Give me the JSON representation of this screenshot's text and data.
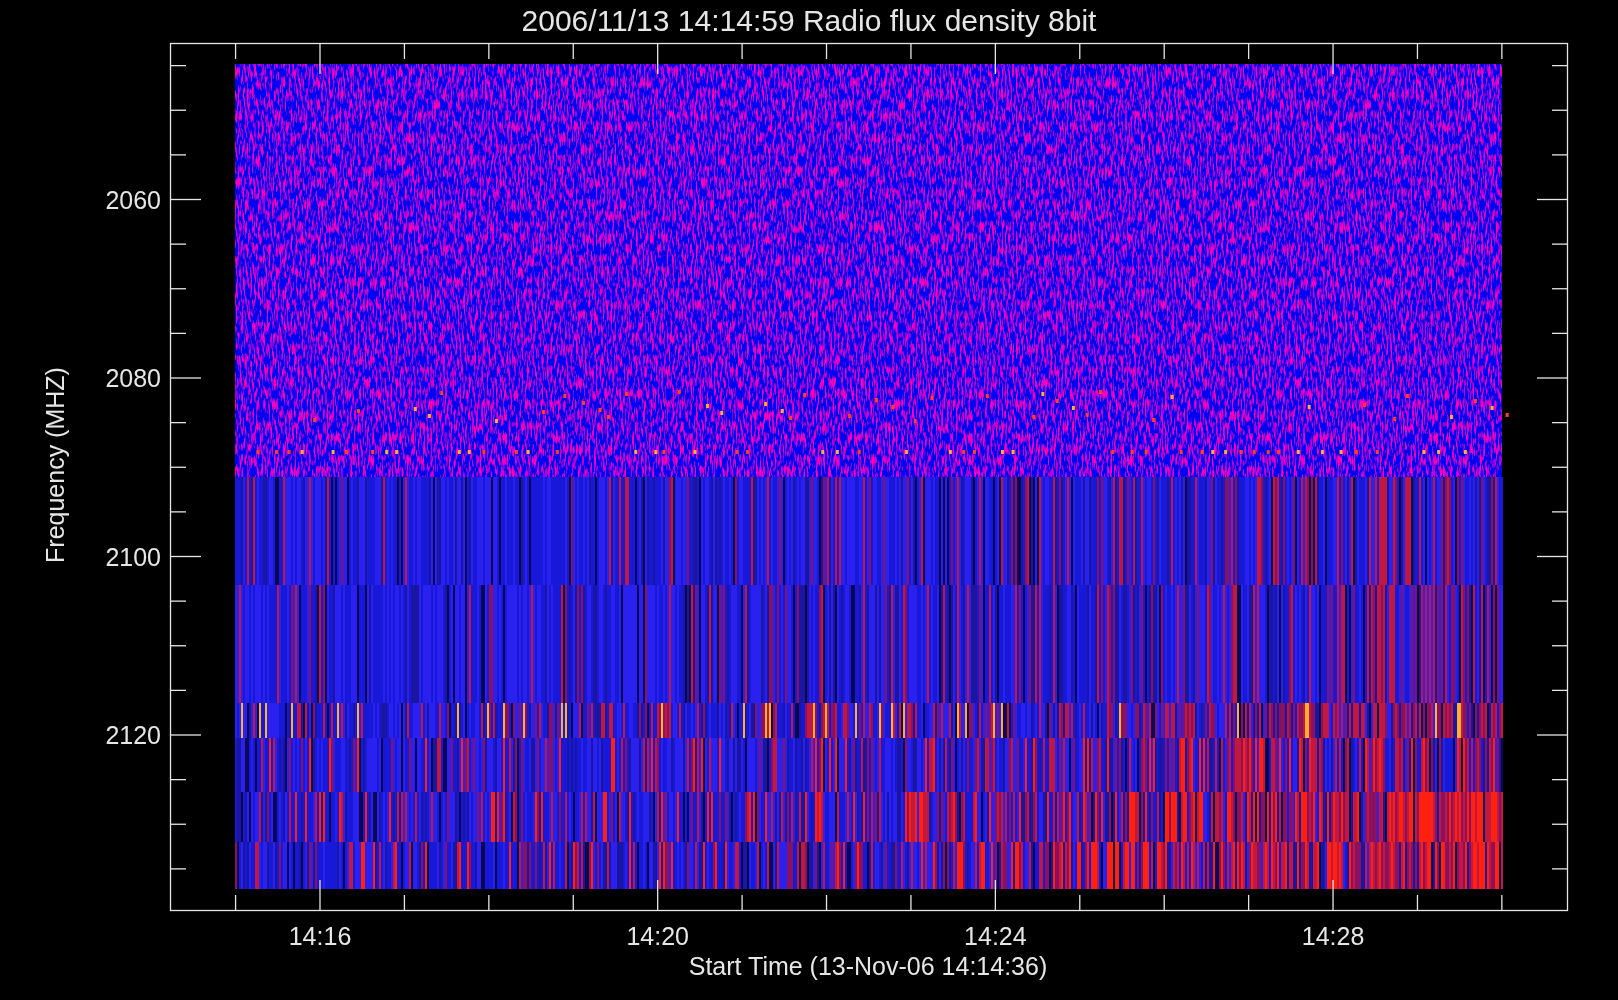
{
  "title": "2006/11/13 14:14:59 Radio flux density 8bit",
  "plot": {
    "xlabel": "Start Time (13-Nov-06 14:14:36)",
    "ylabel": "Frequency (MHZ)",
    "x_tick_labels": [
      "14:16",
      "14:20",
      "14:24",
      "14:28"
    ],
    "y_tick_labels": [
      "2060",
      "2080",
      "2100",
      "2120"
    ]
  }
}
